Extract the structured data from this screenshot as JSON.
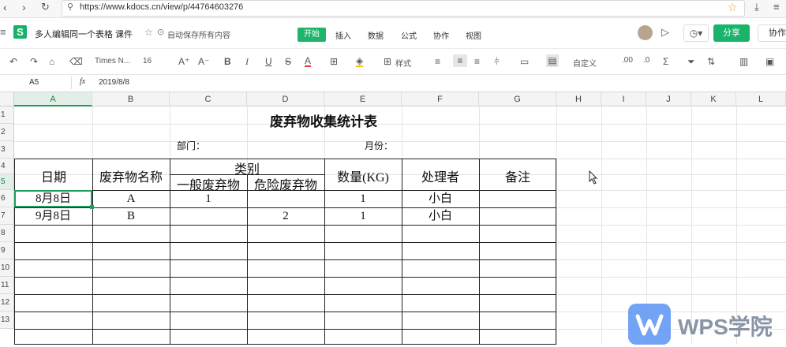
{
  "browser": {
    "url": "https://www.kdocs.cn/view/p/44764603276"
  },
  "app": {
    "doc_title": "多人编辑同一个表格 课件",
    "save_status": "自动保存所有内容",
    "tabs": [
      {
        "label": "开始",
        "active": true
      },
      {
        "label": "插入",
        "active": false
      },
      {
        "label": "数据",
        "active": false
      },
      {
        "label": "公式",
        "active": false
      },
      {
        "label": "协作",
        "active": false
      },
      {
        "label": "视图",
        "active": false
      }
    ],
    "share_label": "分享",
    "collab_label": "协作",
    "accent_color": "#19b46a"
  },
  "toolbar": {
    "font_name": "Times N...",
    "font_size": "16",
    "grow_font": "A⁺",
    "shrink_font": "A⁻",
    "bold": "B",
    "italic": "I",
    "underline": "U",
    "strike": "S",
    "font_color": "A",
    "style_label": "样式",
    "number_format": "自定义"
  },
  "formula_bar": {
    "cell_ref": "A5",
    "fx": "fx",
    "value": "2019/8/8"
  },
  "columns": [
    "A",
    "B",
    "C",
    "D",
    "E",
    "F",
    "G",
    "H",
    "I",
    "J",
    "K",
    "L"
  ],
  "rows": [
    "1",
    "2",
    "3",
    "4",
    "5",
    "6",
    "7",
    "8",
    "9",
    "10",
    "11",
    "12",
    "13"
  ],
  "sheet": {
    "title": "废弃物收集统计表",
    "dept_label": "部门：",
    "month_label": "月份：",
    "headers": {
      "date": "日期",
      "name": "废弃物名称",
      "category": "类别",
      "general": "一般废弃物",
      "hazardous": "危险废弃物",
      "qty": "数量(KG)",
      "handler": "处理者",
      "note": "备注"
    },
    "data_rows": [
      {
        "date": "8月8日",
        "name": "A",
        "general": "1",
        "hazardous": "",
        "qty": "1",
        "handler": "小白",
        "note": ""
      },
      {
        "date": "9月8日",
        "name": "B",
        "general": "",
        "hazardous": "2",
        "qty": "1",
        "handler": "小白",
        "note": ""
      }
    ]
  },
  "watermark": {
    "text": "WPS学院",
    "icon": "wps-logo-icon"
  }
}
